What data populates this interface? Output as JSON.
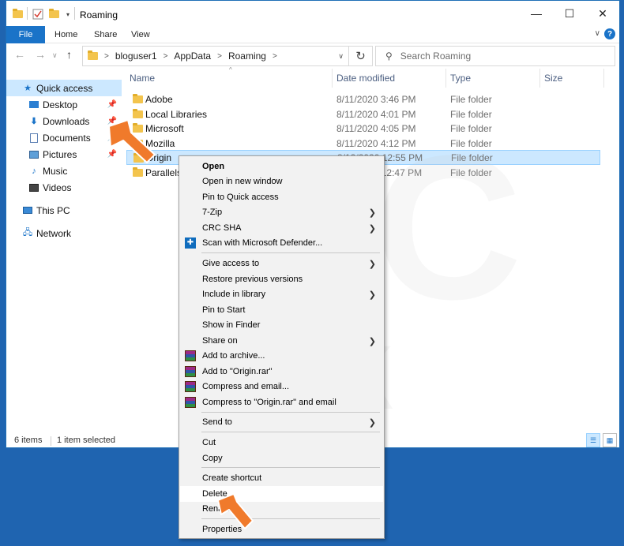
{
  "window": {
    "title": "Roaming",
    "controls": {
      "minimize": "—",
      "maximize": "☐",
      "close": "✕"
    }
  },
  "ribbon": {
    "file": "File",
    "tabs": [
      "Home",
      "Share",
      "View"
    ],
    "help": "?",
    "collapse": "∨"
  },
  "address": {
    "crumbs": [
      "bloguser1",
      "AppData",
      "Roaming"
    ],
    "search_placeholder": "Search Roaming"
  },
  "nav": {
    "quick_access": "Quick access",
    "items": [
      {
        "label": "Desktop",
        "icon": "desktop-icon",
        "pinned": true
      },
      {
        "label": "Downloads",
        "icon": "downloads-icon",
        "pinned": true
      },
      {
        "label": "Documents",
        "icon": "documents-icon",
        "pinned": true
      },
      {
        "label": "Pictures",
        "icon": "pictures-icon",
        "pinned": true
      },
      {
        "label": "Music",
        "icon": "music-icon",
        "pinned": false
      },
      {
        "label": "Videos",
        "icon": "videos-icon",
        "pinned": false
      }
    ],
    "this_pc": "This PC",
    "network": "Network"
  },
  "columns": {
    "name": "Name",
    "date": "Date modified",
    "type": "Type",
    "size": "Size"
  },
  "files": [
    {
      "name": "Adobe",
      "date": "8/11/2020 3:46 PM",
      "type": "File folder"
    },
    {
      "name": "Local Libraries",
      "date": "8/11/2020 4:01 PM",
      "type": "File folder"
    },
    {
      "name": "Microsoft",
      "date": "8/11/2020 4:05 PM",
      "type": "File folder"
    },
    {
      "name": "Mozilla",
      "date": "8/11/2020 4:12 PM",
      "type": "File folder"
    },
    {
      "name": "Origin",
      "date": "8/12/2020 12:55 PM",
      "type": "File folder"
    },
    {
      "name": "Parallels",
      "date": "8/12/2020 12:47 PM",
      "type": "File folder"
    }
  ],
  "status": {
    "count": "6 items",
    "selected": "1 item selected"
  },
  "context_menu": {
    "open": "Open",
    "open_new_window": "Open in new window",
    "pin_quick_access": "Pin to Quick access",
    "seven_zip": "7-Zip",
    "crc_sha": "CRC SHA",
    "scan_defender": "Scan with Microsoft Defender...",
    "give_access": "Give access to",
    "restore_versions": "Restore previous versions",
    "include_library": "Include in library",
    "pin_start": "Pin to Start",
    "show_finder": "Show in Finder",
    "share_on": "Share on",
    "add_archive": "Add to archive...",
    "add_origin_rar": "Add to \"Origin.rar\"",
    "compress_email": "Compress and email...",
    "compress_origin_email": "Compress to \"Origin.rar\" and email",
    "send_to": "Send to",
    "cut": "Cut",
    "copy": "Copy",
    "create_shortcut": "Create shortcut",
    "delete": "Delete",
    "rename": "Rename",
    "properties": "Properties"
  },
  "colors": {
    "accent": "#1a73c8",
    "selection": "#cce8ff",
    "arrow": "#f07a2b"
  }
}
